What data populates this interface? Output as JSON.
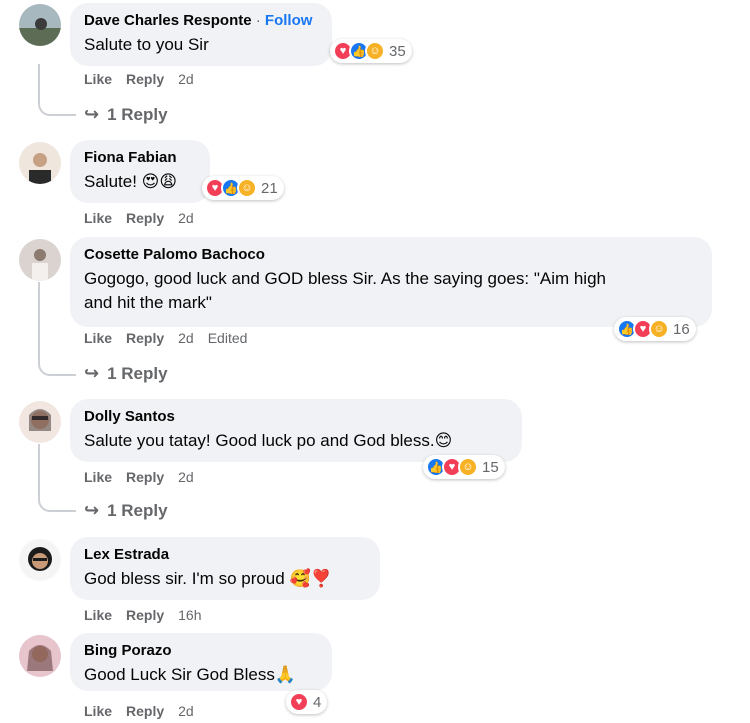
{
  "comments": [
    {
      "author": "Dave Charles Responte",
      "follow_sep": "·",
      "follow": "Follow",
      "text": "Salute to you Sir",
      "reactions": [
        "heart",
        "like",
        "care"
      ],
      "reaction_count": "35",
      "like": "Like",
      "reply": "Reply",
      "time": "2d",
      "replies": "1 Reply",
      "avatar_colors": [
        "#8aa0a8",
        "#5d6d55"
      ]
    },
    {
      "author": "Fiona Fabian",
      "text": "Salute! 😍😩",
      "reactions": [
        "heart",
        "like",
        "care"
      ],
      "reaction_count": "21",
      "like": "Like",
      "reply": "Reply",
      "time": "2d",
      "avatar_colors": [
        "#e8d9cc",
        "#a0785c"
      ]
    },
    {
      "author": "Cosette Palomo Bachoco",
      "text_line1": "Gogogo, good luck and GOD bless Sir. As the saying goes: \"Aim high",
      "text_line2": "and hit the mark\"",
      "reactions": [
        "like",
        "heart",
        "care"
      ],
      "reaction_count": "16",
      "like": "Like",
      "reply": "Reply",
      "time": "2d",
      "edited": "Edited",
      "replies": "1 Reply",
      "avatar_colors": [
        "#d8d0cc",
        "#8c7a70"
      ]
    },
    {
      "author": "Dolly Santos",
      "text": "Salute you tatay! Good luck po and God bless.😊",
      "reactions": [
        "like",
        "heart",
        "care"
      ],
      "reaction_count": "15",
      "like": "Like",
      "reply": "Reply",
      "time": "2d",
      "replies": "1 Reply",
      "avatar_colors": [
        "#f2e6e0",
        "#3a2a28"
      ]
    },
    {
      "author": "Lex Estrada",
      "text": "God bless sir. I'm so proud 🥰❣️",
      "like": "Like",
      "reply": "Reply",
      "time": "16h",
      "avatar_colors": [
        "#1c1c1c",
        "#c89a78"
      ]
    },
    {
      "author": "Bing Porazo",
      "text": "Good Luck Sir God Bless🙏",
      "reactions": [
        "heart"
      ],
      "reaction_count": "4",
      "like": "Like",
      "reply": "Reply",
      "time": "2d",
      "avatar_colors": [
        "#d9a7b0",
        "#5a3a3a"
      ]
    }
  ],
  "colors": {
    "bubble": "#f0f2f5",
    "secondary_text": "#65676b",
    "follow": "#1877f2",
    "heart": "#f33e58",
    "like": "#1877f2",
    "care": "#f7b125"
  }
}
